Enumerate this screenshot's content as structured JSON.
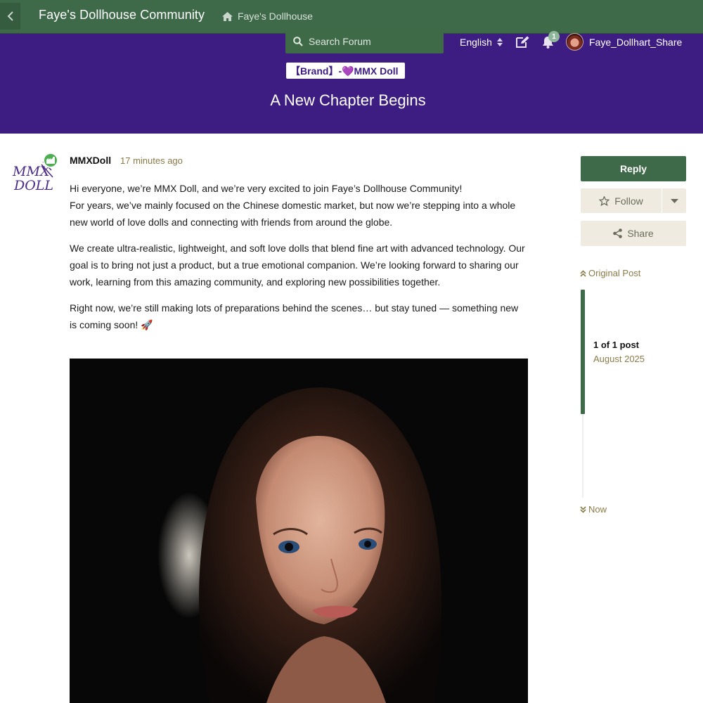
{
  "header": {
    "site_title": "Faye's Dollhouse Community",
    "home_label": "Faye's Dollhouse"
  },
  "toolbar": {
    "search_placeholder": "Search Forum",
    "language": "English",
    "notification_count": "1",
    "username": "Faye_Dollhart_Share"
  },
  "topic": {
    "category_badge": "【Brand】-💜MMX Doll",
    "title": "A New Chapter Begins"
  },
  "post": {
    "avatar_text_line1": "MMX",
    "avatar_text_line2": "DOLL",
    "author": "MMXDoll",
    "time": "17 minutes ago",
    "paragraph1_line1": "Hi everyone, we’re MMX Doll, and we’re very excited to join Faye’s Dollhouse Community!",
    "paragraph1_line2": "For years, we’ve mainly focused on the Chinese domestic market, but now we’re stepping into a whole new world of love dolls and connecting with friends from around the globe.",
    "paragraph2": "We create ultra-realistic, lightweight, and soft love dolls that blend fine art with advanced technology. Our goal is to bring not just a product, but a true emotional companion. We’re looking forward to sharing our work, learning from this amazing community, and exploring new possibilities together.",
    "paragraph3": "Right now, we’re still making lots of preparations behind the scenes… but stay tuned — something new is coming soon! 🚀"
  },
  "sidebar": {
    "reply_label": "Reply",
    "follow_label": "Follow",
    "share_label": "Share",
    "original_post_label": "Original Post",
    "position_count": "1 of 1 post",
    "position_date": "August 2025",
    "now_label": "Now",
    "scroll_progress": 1.0
  },
  "colors": {
    "header_green": "#3f6a4a",
    "hero_purple": "#3d1d82",
    "accent_tan": "#8a7b4a",
    "button_beige": "#efebe0"
  },
  "icons": [
    "chevron-left-icon",
    "home-icon",
    "search-icon",
    "sort-icon",
    "compose-icon",
    "bell-icon",
    "star-icon",
    "caret-down-icon",
    "share-icon",
    "double-chevron-up-icon",
    "double-chevron-down-icon",
    "group-flair-icon"
  ]
}
